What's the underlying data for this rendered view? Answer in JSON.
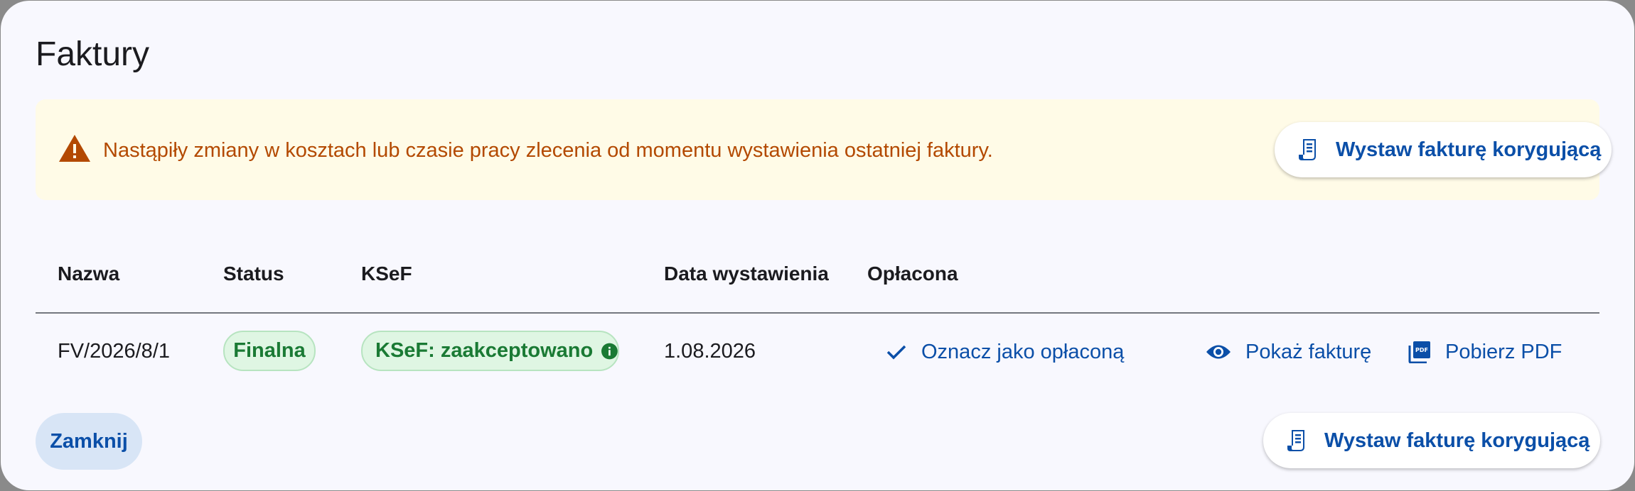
{
  "dialog": {
    "title": "Faktury",
    "close_label": "Zamknij"
  },
  "warning": {
    "icon": "warning-triangle-icon",
    "message": "Nastąpiły zmiany w kosztach lub czasie pracy zlecenia od momentu wystawienia ostatniej faktury.",
    "button_label": "Wystaw fakturę korygującą"
  },
  "table": {
    "columns": [
      "Nazwa",
      "Status",
      "KSeF",
      "Data wystawienia",
      "Opłacona"
    ],
    "rows": [
      {
        "name": "FV/2026/8/1",
        "status": "Finalna",
        "ksef": "KSeF: zaakceptowano",
        "date": "1.08.2026",
        "mark_paid_label": "Oznacz jako opłaconą",
        "show_label": "Pokaż fakturę",
        "pdf_label": "Pobierz PDF"
      }
    ]
  },
  "footer": {
    "correction_label": "Wystaw fakturę korygującą"
  },
  "colors": {
    "accent": "#0b4fa8",
    "warning_text": "#b34900",
    "warning_bg": "#fffbe7",
    "success": "#1a7a34",
    "success_bg": "#dff6e3"
  }
}
